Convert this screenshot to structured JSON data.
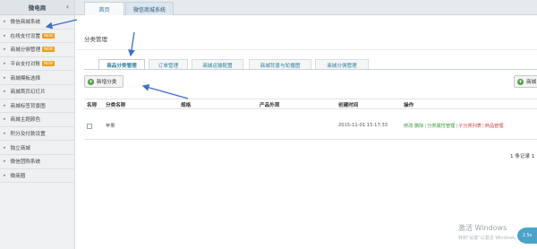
{
  "sidebar": {
    "title": "微电商",
    "items": [
      {
        "label": "微信商城系统",
        "new": ""
      },
      {
        "label": "在线支付设置",
        "new": "NEW"
      },
      {
        "label": "商城分佣管理",
        "new": "NEW"
      },
      {
        "label": "平台支付对账",
        "new": "NEW"
      },
      {
        "label": "商城模板选择",
        "new": ""
      },
      {
        "label": "商城首页幻灯片",
        "new": ""
      },
      {
        "label": "商城标签背景图",
        "new": ""
      },
      {
        "label": "商城主题颜色",
        "new": ""
      },
      {
        "label": "积分及付款设置",
        "new": ""
      },
      {
        "label": "独立商城",
        "new": ""
      },
      {
        "label": "微信团购系统",
        "new": ""
      },
      {
        "label": "微商圈",
        "new": ""
      }
    ]
  },
  "topbar": {
    "tabs": [
      "首页",
      "微信商城系统"
    ]
  },
  "page": {
    "title": "分类管理",
    "subtabs": [
      "商品分类管理",
      "订单管理",
      "商城运输配置",
      "商城背景与轮播图",
      "商城分佣管理"
    ],
    "add_button": "新增分类",
    "right_button": "商城"
  },
  "table": {
    "headers": [
      "名称",
      "分类名称",
      "规格",
      "产品外观",
      "创建时间",
      "操作"
    ],
    "rows": [
      {
        "category": "苹果",
        "created": "2015-11-01 15:17:33",
        "ops": [
          {
            "label": "修改",
            "style": "green"
          },
          {
            "label": "删除",
            "style": "green"
          },
          {
            "label": "分类属性管理",
            "style": "green"
          },
          {
            "label": "子分类列表",
            "style": "red"
          },
          {
            "label": "商品管理",
            "style": "red"
          }
        ]
      }
    ]
  },
  "pager": {
    "text": "1 条记录 1"
  },
  "watermark": {
    "line1": "激活 Windows",
    "line2": "转到\"设置\"以激活 Windows。",
    "bubble": "2.5s"
  },
  "colors": {
    "annotation_arrow": "#3b6fd0",
    "new_badge": "#f39b1e",
    "add_icon": "#45a13b"
  }
}
